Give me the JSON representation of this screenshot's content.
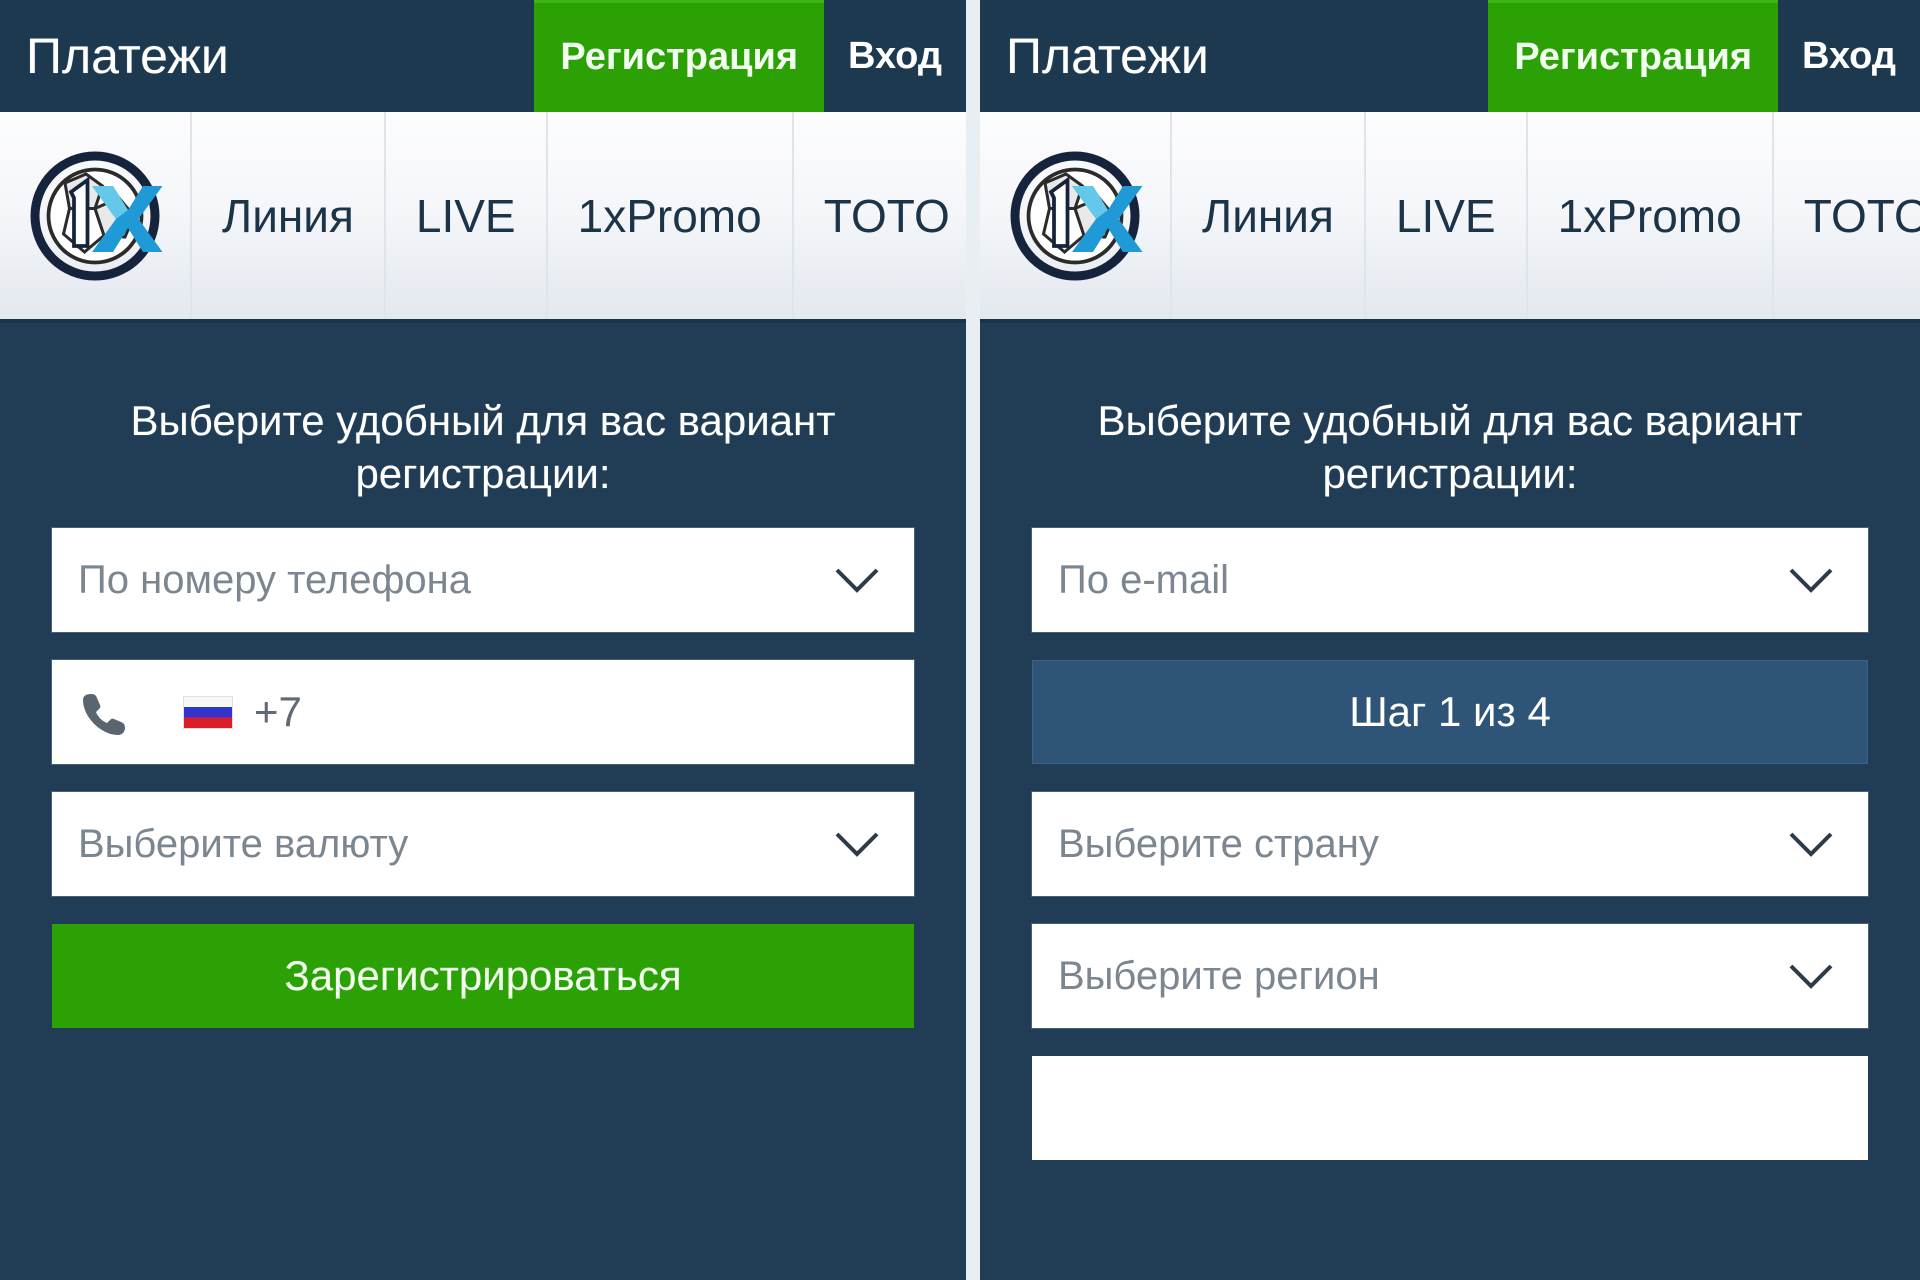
{
  "brand": {
    "logo_icon": "1xbet-logo-icon",
    "accent_green": "#2ba105",
    "navy": "#203d55",
    "step_blue": "#2e5578"
  },
  "panels": [
    {
      "id": "left",
      "topbar": {
        "title": "Платежи",
        "register_label": "Регистрация",
        "login_label": "Вход"
      },
      "nav": {
        "items": [
          {
            "label": "Линия"
          },
          {
            "label": "LIVE"
          },
          {
            "label": "1xPromo"
          },
          {
            "label": "TOTO"
          }
        ]
      },
      "main": {
        "headline": "Выберите удобный для вас вариант регистрации:",
        "method_select": {
          "value": "По номеру телефона",
          "icon": "chevron-down-icon"
        },
        "phone": {
          "phone_icon": "phone-icon",
          "flag_icon": "flag-russia-icon",
          "dial_code": "+7"
        },
        "currency_select": {
          "value": "Выберите валюту",
          "icon": "chevron-down-icon"
        },
        "submit_label": "Зарегистрироваться"
      }
    },
    {
      "id": "right",
      "topbar": {
        "title": "Платежи",
        "register_label": "Регистрация",
        "login_label": "Вход"
      },
      "nav": {
        "items": [
          {
            "label": "Линия"
          },
          {
            "label": "LIVE"
          },
          {
            "label": "1xPromo"
          },
          {
            "label": "TOTO"
          }
        ]
      },
      "main": {
        "headline": "Выберите удобный для вас вариант регистрации:",
        "method_select": {
          "value": "По e-mail",
          "icon": "chevron-down-icon"
        },
        "step_label": "Шаг 1 из 4",
        "country_select": {
          "value": "Выберите страну",
          "icon": "chevron-down-icon"
        },
        "region_select": {
          "value": "Выберите регион",
          "icon": "chevron-down-icon"
        }
      }
    }
  ]
}
